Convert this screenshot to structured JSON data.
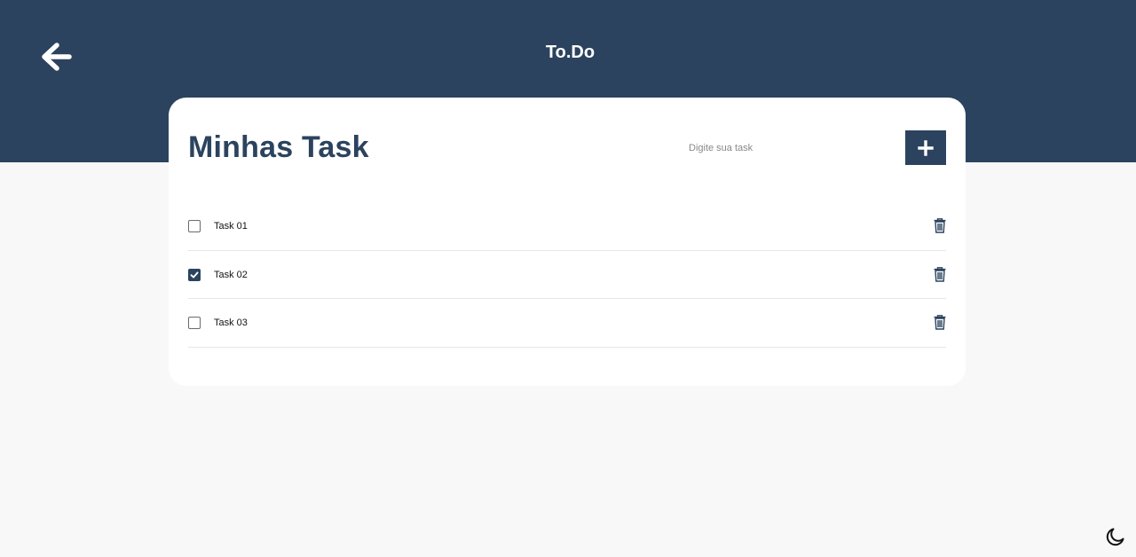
{
  "header": {
    "title": "To.Do",
    "back_icon": "arrow-left-icon",
    "background": "#2b435e"
  },
  "card": {
    "title": "Minhas Task",
    "input": {
      "placeholder": "Digite sua task",
      "value": ""
    },
    "add_button_icon": "plus-icon"
  },
  "tasks": [
    {
      "label": "Task 01",
      "checked": false,
      "delete_icon": "trash-icon"
    },
    {
      "label": "Task 02",
      "checked": true,
      "delete_icon": "trash-icon"
    },
    {
      "label": "Task 03",
      "checked": false,
      "delete_icon": "trash-icon"
    }
  ],
  "theme_toggle": {
    "icon": "moon-icon"
  },
  "colors": {
    "accent": "#2b435e",
    "page_background": "#f8f8f8",
    "card_background": "#ffffff"
  }
}
